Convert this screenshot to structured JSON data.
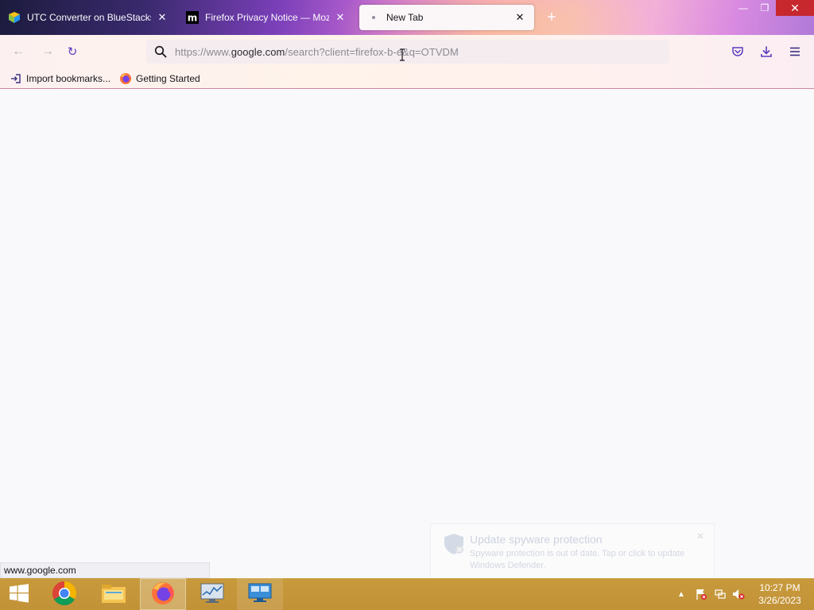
{
  "browser": {
    "tabs": [
      {
        "label": "UTC Converter on BlueStacks",
        "icon": "bluestacks-icon",
        "active": false
      },
      {
        "label": "Firefox Privacy Notice — Mozilla",
        "icon": "mozilla-m-icon",
        "active": false
      },
      {
        "label": "New Tab",
        "icon": "dot-icon",
        "active": true
      }
    ],
    "close_glyph": "✕",
    "new_tab_glyph": "+"
  },
  "window_controls": {
    "minimize": "—",
    "maximize": "❐",
    "close": "✕"
  },
  "nav": {
    "back_glyph": "←",
    "forward_glyph": "→",
    "reload_glyph": "↻",
    "url_prefix": "https://www.",
    "url_domain": "google.com",
    "url_suffix": "/search?client=firefox-b-e&q=OTVDM"
  },
  "bookmarks": [
    {
      "label": "Import bookmarks...",
      "icon": "import-icon"
    },
    {
      "label": "Getting Started",
      "icon": "firefox-icon"
    }
  ],
  "status_bar": {
    "text": "www.google.com"
  },
  "toast": {
    "title": "Update spyware protection",
    "body": "Spyware protection is out of date. Tap or click to update Windows Defender."
  },
  "taskbar": {
    "apps": [
      "start-icon",
      "chrome-icon",
      "file-explorer-icon",
      "firefox-icon",
      "performance-monitor-icon",
      "remote-desktop-icon"
    ],
    "clock_time": "10:27 PM",
    "clock_date": "3/26/2023"
  },
  "colors": {
    "accent": "#5b3bbf",
    "close_red": "#c7282d",
    "taskbar": "#c29237"
  }
}
